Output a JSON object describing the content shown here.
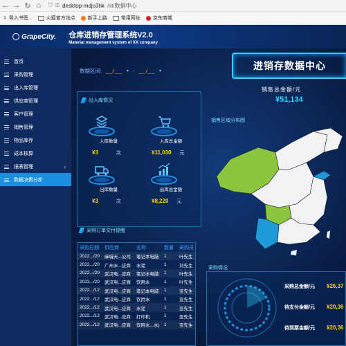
{
  "browser": {
    "url_host": "desktop-mdjo3hk",
    "url_path": "/xt/数据中心",
    "bookmarks": [
      "导入书签...",
      "火狐官方站点",
      "新手上路",
      "常用网址",
      "京东商城"
    ]
  },
  "header": {
    "logo_text": "GrapeCity.",
    "title": "仓库进销存管理系统V2.0",
    "subtitle": "Material management system of XX company"
  },
  "sidebar": {
    "items": [
      {
        "label": "首页"
      },
      {
        "label": "采购管理"
      },
      {
        "label": "出入库管理"
      },
      {
        "label": "供应商管理"
      },
      {
        "label": "客户管理"
      },
      {
        "label": "销售管理"
      },
      {
        "label": "物品库存"
      },
      {
        "label": "成本核算"
      },
      {
        "label": "报表管理"
      },
      {
        "label": "数据决策分析"
      }
    ]
  },
  "dashboard": {
    "date_label": "数据区间:",
    "date_from": "__/__",
    "date_to": "__/__",
    "date_sep": "-",
    "banner_title": "进销存数据中心",
    "sales_total_label": "销售总金额/元",
    "sales_total_value": "¥51,134",
    "inout_title": "出入库情况",
    "stats": [
      {
        "label": "入库数量",
        "value": "¥3",
        "unit": "次"
      },
      {
        "label": "入库总金额",
        "value": "¥11,030",
        "unit": "元"
      },
      {
        "label": "出库数量",
        "value": "¥3",
        "unit": "次"
      },
      {
        "label": "出库总金额",
        "value": "¥8,220",
        "unit": "元"
      }
    ],
    "map_title": "销售区域分布图",
    "orders_title": "采购订单交付提醒",
    "orders_columns": [
      "采购日期",
      "供应商",
      "名称",
      "数量",
      "采购员"
    ],
    "orders_rows": [
      [
        "2022.../20",
        "麻城天...公司",
        "笔记本电脑",
        "1",
        "叶先生"
      ],
      [
        "2022.../20",
        "广州水...应商",
        "水泥",
        "1",
        "刘先生"
      ],
      [
        "2022.../20",
        "武汉电...应商",
        "笔记本电脑",
        "1",
        "叶先生"
      ],
      [
        "2022.../20",
        "武汉电...应商",
        "饮用水",
        "1",
        "叶先生"
      ],
      [
        "2022.../12",
        "武汉电...应商",
        "笔记本电脑",
        "1",
        "亚先生"
      ],
      [
        "2022.../12",
        "武汉电...应商",
        "饮用水",
        "1",
        "亚先生"
      ],
      [
        "2022.../12",
        "武汉电...应商",
        "水泥",
        "1",
        "亚先生"
      ],
      [
        "2022.../12",
        "武汉电...应商",
        "打印机",
        "1",
        "亚先生"
      ],
      [
        "2022.../12",
        "武汉电...应商",
        "饮用水...水)",
        "1",
        "亚先生"
      ]
    ],
    "purchase_title": "采购情况",
    "purchase_items": [
      {
        "label": "采购总金额/元",
        "value": "¥26,37"
      },
      {
        "label": "待支付金额/元",
        "value": "¥20,36"
      },
      {
        "label": "待到票金额/元",
        "value": "¥20,36"
      }
    ]
  },
  "colors": {
    "accent": "#1d8fe0",
    "highlight": "#ffd21a",
    "map_green": "#8dc53e",
    "map_blue": "#1e9ad6"
  }
}
